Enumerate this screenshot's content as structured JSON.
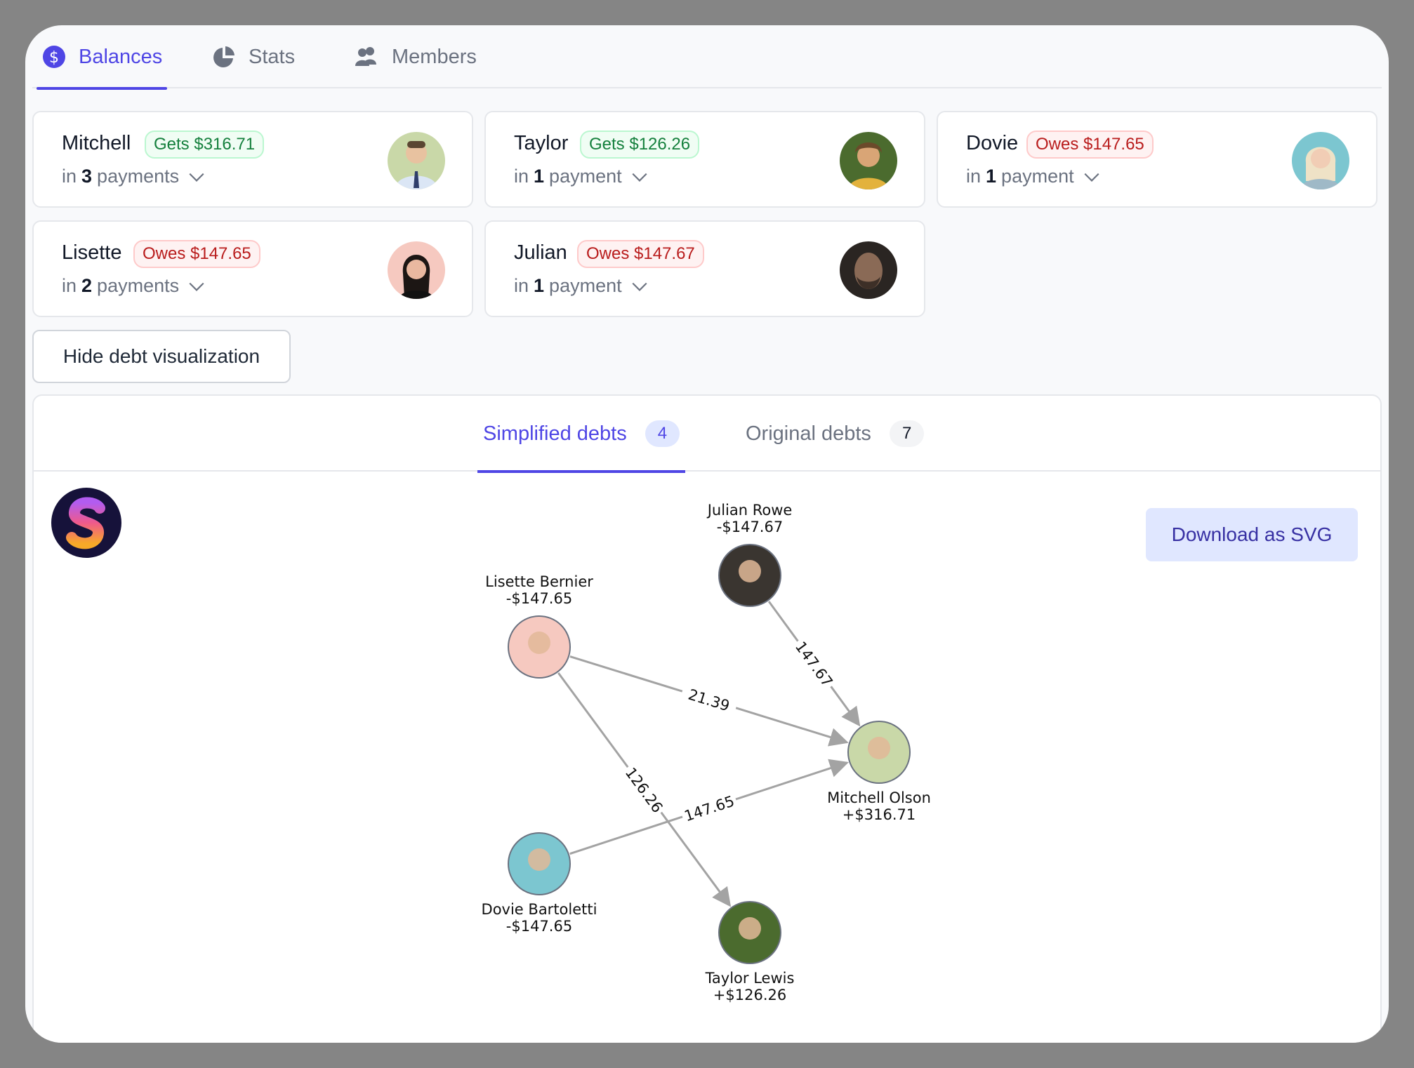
{
  "tabs": [
    {
      "label": "Balances",
      "icon": "dollar-circle-icon",
      "active": true
    },
    {
      "label": "Stats",
      "icon": "pie-chart-icon",
      "active": false
    },
    {
      "label": "Members",
      "icon": "users-icon",
      "active": false
    }
  ],
  "balances": [
    {
      "first": "Mitchell",
      "badge": "Gets $316.71",
      "status": "gets",
      "in": "in",
      "count": "3",
      "unit": "payments",
      "avatar_color": "#c9d8a8"
    },
    {
      "first": "Taylor",
      "badge": "Gets $126.26",
      "status": "gets",
      "in": "in",
      "count": "1",
      "unit": "payment",
      "avatar_color": "#4b6b2e"
    },
    {
      "first": "Dovie",
      "badge": "Owes $147.65",
      "status": "owes",
      "in": "in",
      "count": "1",
      "unit": "payment",
      "avatar_color": "#7cc6d0"
    },
    {
      "first": "Lisette",
      "badge": "Owes $147.65",
      "status": "owes",
      "in": "in",
      "count": "2",
      "unit": "payments",
      "avatar_color": "#f6c9c0"
    },
    {
      "first": "Julian",
      "badge": "Owes $147.67",
      "status": "owes",
      "in": "in",
      "count": "1",
      "unit": "payment",
      "avatar_color": "#3a3530"
    }
  ],
  "hide_button": "Hide debt visualization",
  "viz_tabs": [
    {
      "label": "Simplified debts",
      "count": "4",
      "active": true
    },
    {
      "label": "Original debts",
      "count": "7",
      "active": false
    }
  ],
  "download_button": "Download as SVG",
  "graph": {
    "nodes": [
      {
        "id": "julian",
        "name": "Julian Rowe",
        "amount": "-$147.67",
        "color": "#3a3530"
      },
      {
        "id": "lisette",
        "name": "Lisette Bernier",
        "amount": "-$147.65",
        "color": "#f6c9c0"
      },
      {
        "id": "mitchell",
        "name": "Mitchell Olson",
        "amount": "+$316.71",
        "color": "#c9d8a8"
      },
      {
        "id": "dovie",
        "name": "Dovie Bartoletti",
        "amount": "-$147.65",
        "color": "#7cc6d0"
      },
      {
        "id": "taylor",
        "name": "Taylor Lewis",
        "amount": "+$126.26",
        "color": "#4b6b2e"
      }
    ],
    "edges": [
      {
        "from": "julian",
        "to": "mitchell",
        "label": "147.67"
      },
      {
        "from": "lisette",
        "to": "mitchell",
        "label": "21.39"
      },
      {
        "from": "lisette",
        "to": "taylor",
        "label": "126.26"
      },
      {
        "from": "dovie",
        "to": "mitchell",
        "label": "147.65"
      }
    ]
  },
  "colors": {
    "accent": "#4f46e5",
    "gets": "#15803d",
    "owes": "#b91c1c"
  }
}
